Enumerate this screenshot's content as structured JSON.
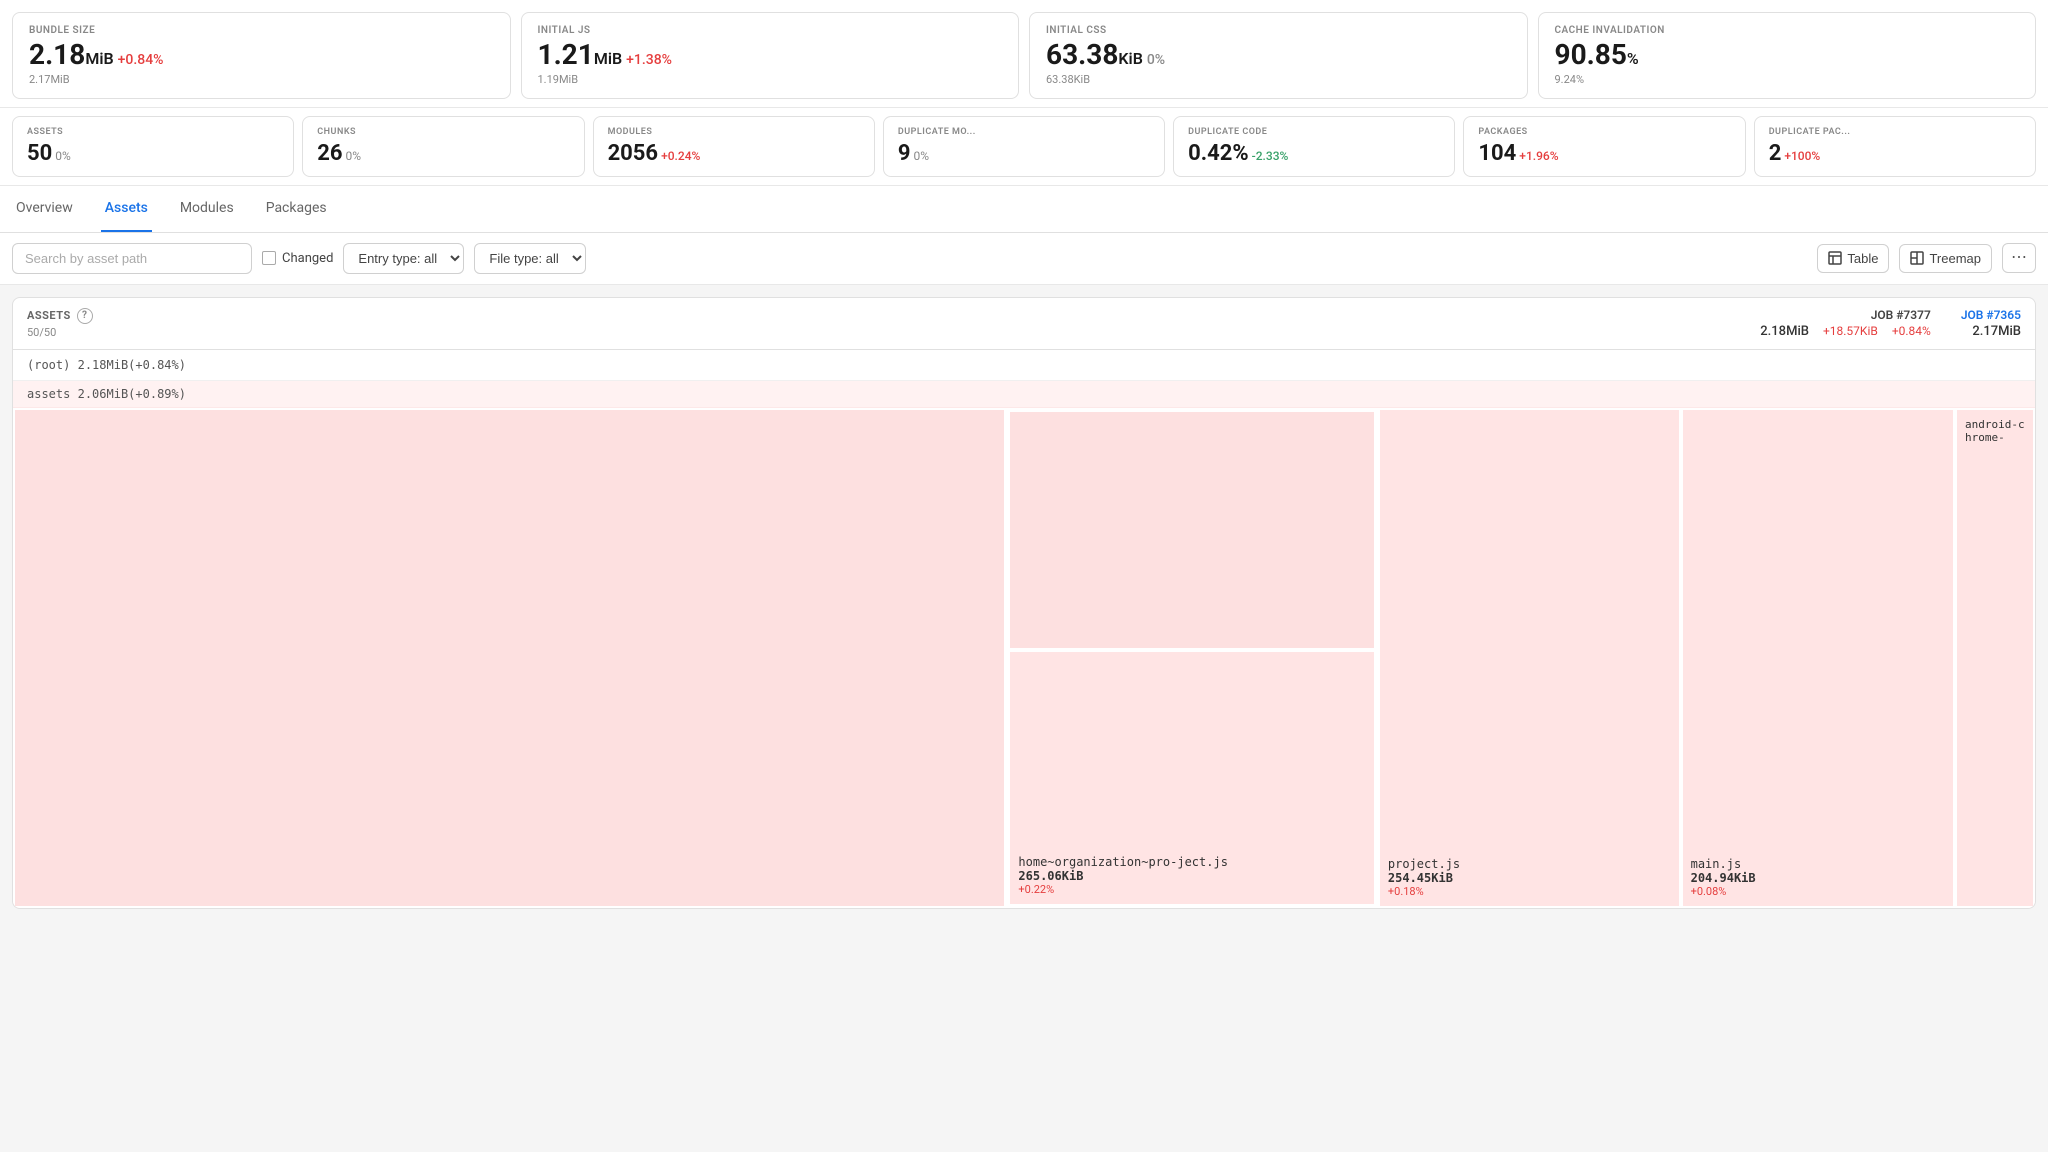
{
  "top_metrics": [
    {
      "id": "bundle-size",
      "label": "BUNDLE SIZE",
      "value": "2.18",
      "unit": "MiB",
      "change": "+0.84%",
      "change_type": "pos",
      "sub": "2.17MiB"
    },
    {
      "id": "initial-js",
      "label": "INITIAL JS",
      "value": "1.21",
      "unit": "MiB",
      "change": "+1.38%",
      "change_type": "pos",
      "sub": "1.19MiB"
    },
    {
      "id": "initial-css",
      "label": "INITIAL CSS",
      "value": "63.38",
      "unit": "KiB",
      "change": "0%",
      "change_type": "neutral",
      "sub": "63.38KiB"
    },
    {
      "id": "cache-invalidation",
      "label": "CACHE INVALIDATION",
      "value": "90.85",
      "unit": "%",
      "change": "",
      "change_type": "neutral",
      "sub": "9.24%"
    }
  ],
  "secondary_metrics": [
    {
      "id": "assets",
      "label": "ASSETS",
      "value": "50",
      "change": "0%",
      "change_type": "neutral"
    },
    {
      "id": "chunks",
      "label": "CHUNKS",
      "value": "26",
      "change": "0%",
      "change_type": "neutral"
    },
    {
      "id": "modules",
      "label": "MODULES",
      "value": "2056",
      "change": "+0.24%",
      "change_type": "pos"
    },
    {
      "id": "duplicate-mo",
      "label": "DUPLICATE MO...",
      "value": "9",
      "change": "0%",
      "change_type": "neutral"
    },
    {
      "id": "duplicate-code",
      "label": "DUPLICATE CODE",
      "value": "0.42%",
      "change": "-2.33%",
      "change_type": "neg"
    },
    {
      "id": "packages",
      "label": "PACKAGES",
      "value": "104",
      "change": "+1.96%",
      "change_type": "pos"
    },
    {
      "id": "duplicate-pac",
      "label": "DUPLICATE PAC...",
      "value": "2",
      "change": "+100%",
      "change_type": "pos"
    }
  ],
  "tabs": [
    {
      "id": "overview",
      "label": "Overview",
      "active": false
    },
    {
      "id": "assets",
      "label": "Assets",
      "active": true
    },
    {
      "id": "modules",
      "label": "Modules",
      "active": false
    },
    {
      "id": "packages",
      "label": "Packages",
      "active": false
    }
  ],
  "filters": {
    "search_placeholder": "Search by asset path",
    "changed_label": "Changed",
    "entry_type_label": "Entry type: all",
    "file_type_label": "File type: all",
    "table_label": "Table",
    "treemap_label": "Treemap"
  },
  "assets_panel": {
    "title": "ASSETS",
    "count": "50/50",
    "job_current": "JOB #7377",
    "job_compare": "JOB #7365",
    "current_size": "2.18MiB",
    "diff_size": "+18.57KiB",
    "diff_pct": "+0.84%",
    "compare_size": "2.17MiB",
    "root_label": "(root)",
    "root_value": "2.18MiB(+0.84%)",
    "assets_label": "assets",
    "assets_value": "2.06MiB(+0.89%)",
    "treemap_cells": [
      {
        "id": "large-cell",
        "label": "",
        "size": "",
        "change": "",
        "col_span": 1
      },
      {
        "id": "home-org",
        "label": "home~organization~pro-ject.js",
        "size": "265.06KiB",
        "change": "+0.22%"
      },
      {
        "id": "project-js",
        "label": "project.js",
        "size": "254.45KiB",
        "change": "+0.18%"
      },
      {
        "id": "main-js",
        "label": "main.js",
        "size": "204.94KiB",
        "change": "+0.08%"
      },
      {
        "id": "android-chrome",
        "label": "android-chrome-"
      }
    ]
  }
}
